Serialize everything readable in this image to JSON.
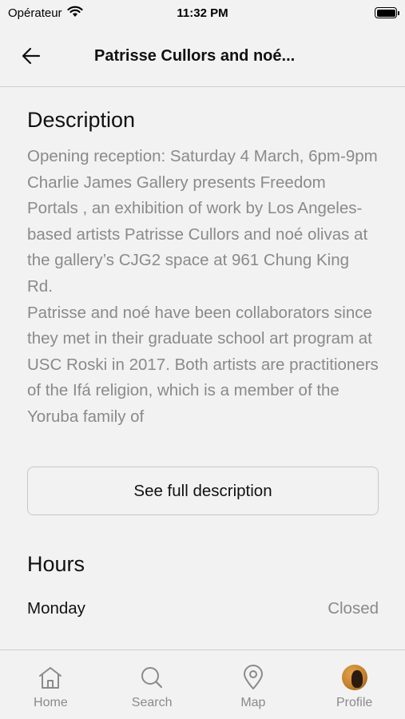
{
  "status_bar": {
    "carrier": "Opérateur",
    "time": "11:32 PM",
    "battery_level": 1.0
  },
  "nav": {
    "title": "Patrisse Cullors and noé..."
  },
  "description": {
    "heading": "Description",
    "paragraphs": [
      "Opening reception: Saturday 4 March, 6pm-9pm",
      "Charlie James Gallery presents Freedom Portals , an exhibition of work by Los Angeles-based artists Patrisse Cullors and noé olivas at the gallery’s CJG2 space at 961 Chung King Rd.",
      "Patrisse and noé have been collaborators since they met in their graduate school art program at USC Roski in 2017. Both artists are practitioners of the Ifá religion, which is a member of the Yoruba family of"
    ],
    "full_button": "See full description"
  },
  "hours": {
    "heading": "Hours",
    "rows": [
      {
        "day": "Monday",
        "status": "Closed"
      }
    ]
  },
  "tabs": [
    {
      "label": "Home",
      "icon": "home-icon"
    },
    {
      "label": "Search",
      "icon": "search-icon"
    },
    {
      "label": "Map",
      "icon": "map-pin-icon"
    },
    {
      "label": "Profile",
      "icon": "avatar"
    }
  ],
  "colors": {
    "background": "#f2f2f2",
    "text": "#111111",
    "muted": "#8a8a8a",
    "divider": "#cfcfcf"
  }
}
